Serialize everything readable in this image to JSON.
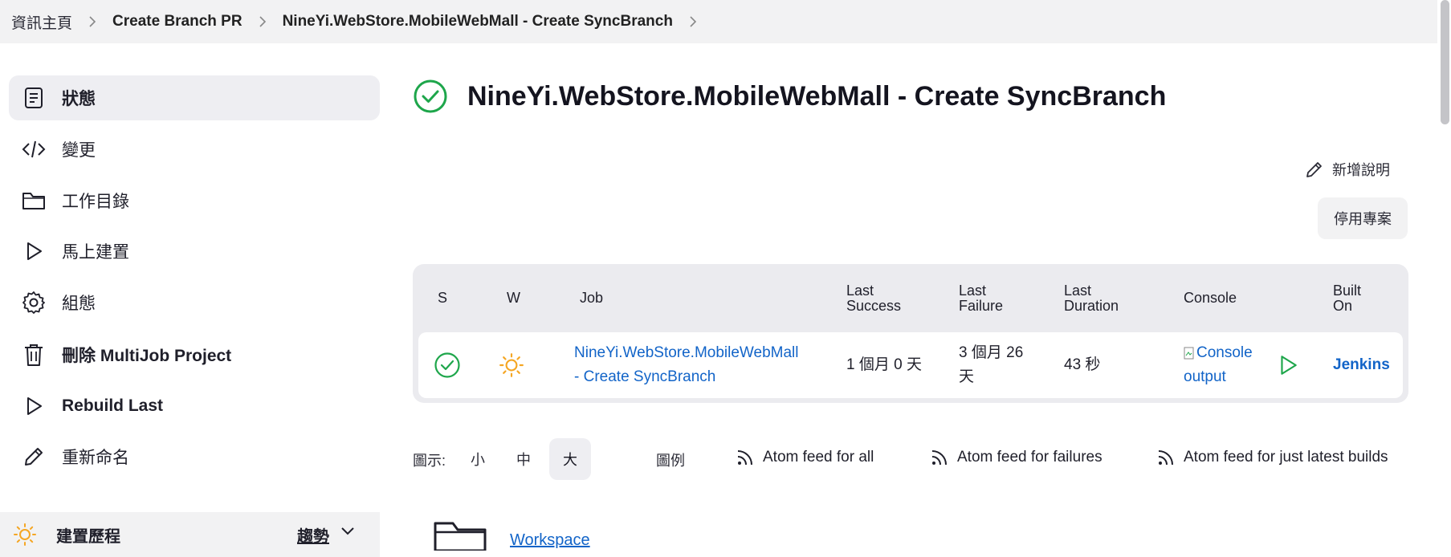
{
  "breadcrumb": {
    "items": [
      "資訊主頁",
      "Create Branch PR",
      "NineYi.WebStore.MobileWebMall - Create SyncBranch"
    ]
  },
  "sidebar": {
    "items": [
      {
        "label": "狀態",
        "icon": "status-document-icon"
      },
      {
        "label": "變更",
        "icon": "code-icon"
      },
      {
        "label": "工作目錄",
        "icon": "folder-icon"
      },
      {
        "label": "馬上建置",
        "icon": "play-icon"
      },
      {
        "label": "組態",
        "icon": "gear-icon"
      },
      {
        "label": "刪除 MultiJob Project",
        "icon": "trash-icon"
      },
      {
        "label": "Rebuild Last",
        "icon": "play-icon"
      },
      {
        "label": "重新命名",
        "icon": "pencil-icon"
      }
    ],
    "build_history": {
      "title": "建置歷程",
      "trend": "趨勢"
    }
  },
  "main": {
    "title": "NineYi.WebStore.MobileWebMall - Create SyncBranch",
    "add_description": "新增說明",
    "disable_project": "停用專案"
  },
  "table": {
    "headers": {
      "s": "S",
      "w": "W",
      "job": "Job",
      "last_success_1": "Last",
      "last_success_2": "Success",
      "last_failure_1": "Last",
      "last_failure_2": "Failure",
      "last_duration_1": "Last",
      "last_duration_2": "Duration",
      "console": "Console",
      "built_on_1": "Built",
      "built_on_2": "On"
    },
    "row": {
      "job_line1": "NineYi.WebStore.MobileWebMall",
      "job_line2": "- Create SyncBranch",
      "last_success": "1 個月 0 天",
      "last_failure_1": "3 個月 26",
      "last_failure_2": "天",
      "last_duration": "43 秒",
      "console_alt_1": "Console",
      "console_alt_2": "output",
      "built_on": "Jenkins"
    }
  },
  "view_options": {
    "label": "圖示:",
    "sizes": [
      "小",
      "中",
      "大"
    ],
    "selected": "大",
    "legend": "圖例",
    "feeds": [
      "Atom feed for all",
      "Atom feed for failures",
      "Atom feed for just latest builds"
    ]
  },
  "workspace": {
    "label": "Workspace"
  },
  "colors": {
    "success": "#1ea64b",
    "sunny": "#f5a623",
    "link": "#1264c8"
  }
}
